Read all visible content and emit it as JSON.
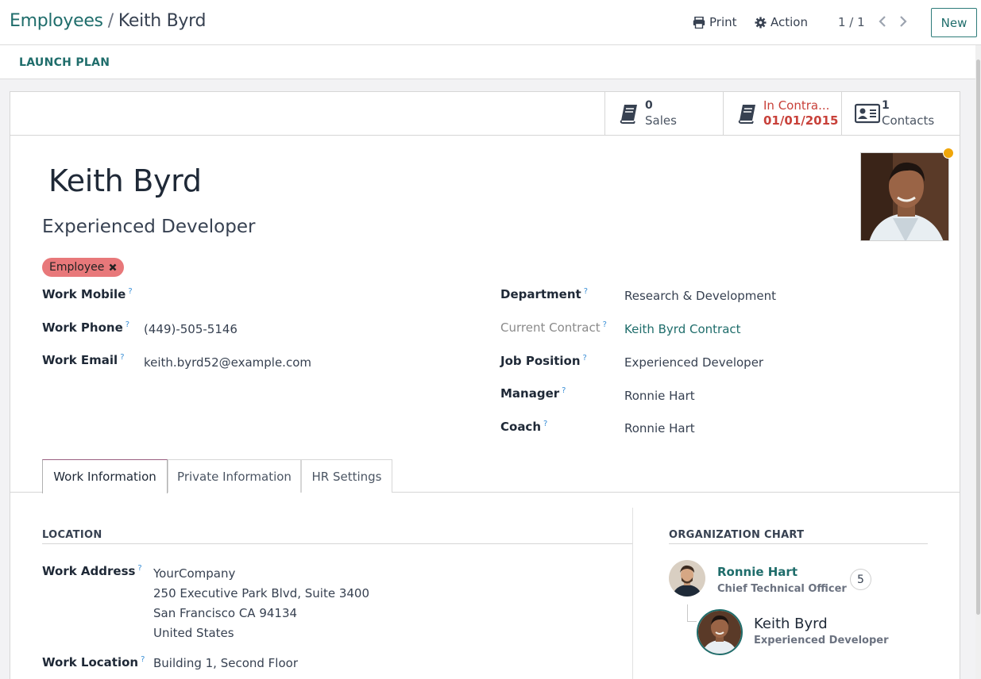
{
  "breadcrumb": {
    "parent": "Employees",
    "separator": "/",
    "current": "Keith Byrd"
  },
  "toolbar": {
    "print_label": "Print",
    "action_label": "Action",
    "pager": "1 / 1",
    "new_label": "New"
  },
  "statusbar": {
    "launch_plan_label": "LAUNCH PLAN"
  },
  "smart_buttons": {
    "sales": {
      "count": "0",
      "label": "Sales",
      "icon": "book-icon"
    },
    "contract": {
      "status": "In Contra...",
      "date": "01/01/2015",
      "icon": "book-icon"
    },
    "contacts": {
      "count": "1",
      "label": "Contacts",
      "icon": "id-card-icon"
    }
  },
  "employee": {
    "name": "Keith Byrd",
    "job_title": "Experienced Developer",
    "tag": "Employee",
    "status_color": "#f0a60a"
  },
  "fields_left": {
    "work_mobile": {
      "label": "Work Mobile",
      "value": ""
    },
    "work_phone": {
      "label": "Work Phone",
      "value": "(449)-505-5146"
    },
    "work_email": {
      "label": "Work Email",
      "value": "keith.byrd52@example.com"
    }
  },
  "fields_right": {
    "department": {
      "label": "Department",
      "value": "Research & Development"
    },
    "current_contract": {
      "label": "Current Contract",
      "value": "Keith Byrd Contract"
    },
    "job_position": {
      "label": "Job Position",
      "value": "Experienced Developer"
    },
    "manager": {
      "label": "Manager",
      "value": "Ronnie Hart"
    },
    "coach": {
      "label": "Coach",
      "value": "Ronnie Hart"
    }
  },
  "help_marker": "?",
  "tabs": [
    {
      "label": "Work Information",
      "active": true
    },
    {
      "label": "Private Information",
      "active": false
    },
    {
      "label": "HR Settings",
      "active": false
    }
  ],
  "location": {
    "heading": "LOCATION",
    "work_address_label": "Work Address",
    "address_lines": [
      "YourCompany",
      "250 Executive Park Blvd, Suite 3400",
      "San Francisco CA 94134",
      "United States"
    ],
    "work_location_label": "Work Location",
    "work_location_value": "Building 1, Second Floor"
  },
  "org_chart": {
    "heading": "ORGANIZATION CHART",
    "manager": {
      "name": "Ronnie Hart",
      "role": "Chief Technical Officer",
      "reports": "5"
    },
    "self": {
      "name": "Keith Byrd",
      "role": "Experienced Developer"
    }
  },
  "colors": {
    "accent": "#1f6d6b",
    "tag_bg": "#e8787a",
    "alert": "#c8413a"
  }
}
